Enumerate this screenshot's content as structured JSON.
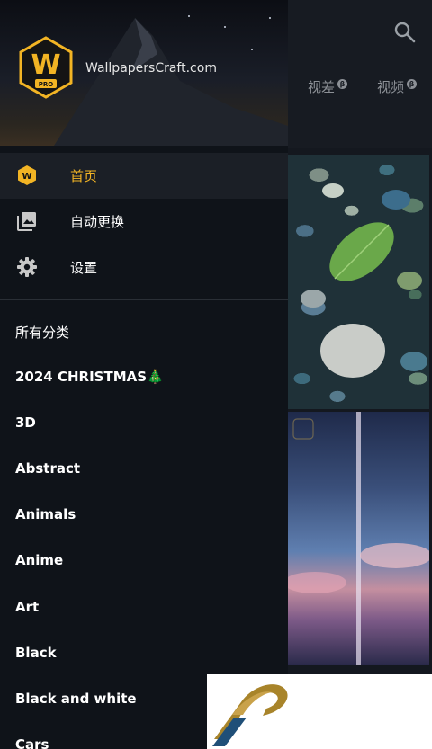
{
  "header": {
    "site_name": "WallpapersCraft.com",
    "logo": {
      "letter": "W",
      "badge": "PRO"
    }
  },
  "top_tabs": [
    {
      "label": "视差",
      "badge": "β"
    },
    {
      "label": "视频",
      "badge": "β"
    }
  ],
  "menu": [
    {
      "label": "首页",
      "icon": "wallpaperscraft-home-icon",
      "active": true
    },
    {
      "label": "自动更换",
      "icon": "image-gallery-icon",
      "active": false
    },
    {
      "label": "设置",
      "icon": "gear-icon",
      "active": false
    }
  ],
  "categories": {
    "heading": "所有分类",
    "items": [
      "2024 CHRISTMAS🎄",
      "3D",
      "Abstract",
      "Animals",
      "Anime",
      "Art",
      "Black",
      "Black and white",
      "Cars"
    ]
  },
  "colors": {
    "accent": "#f2b424",
    "drawer_bg": "#0f1319",
    "active_row_bg": "#1b1f26"
  }
}
